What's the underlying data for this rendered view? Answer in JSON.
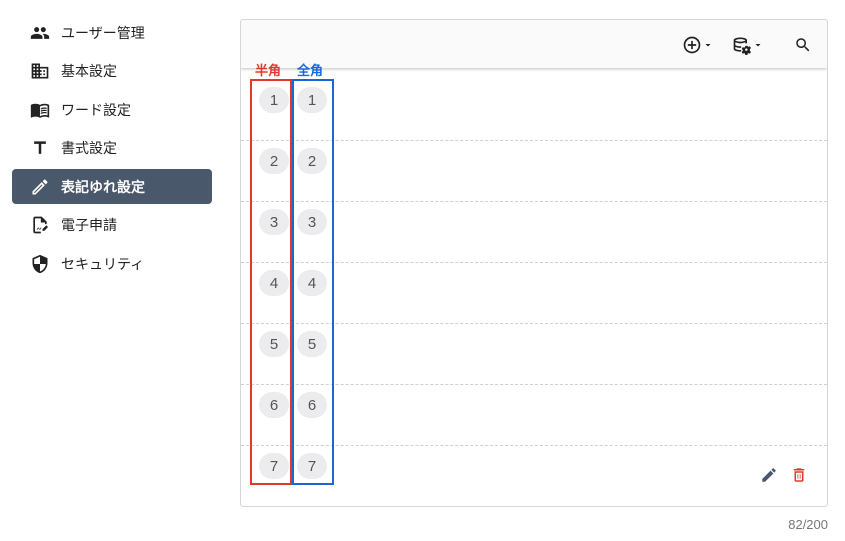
{
  "sidebar": {
    "items": [
      {
        "label": "ユーザー管理",
        "icon": "users-icon",
        "active": false
      },
      {
        "label": "基本設定",
        "icon": "building-icon",
        "active": false
      },
      {
        "label": "ワード設定",
        "icon": "book-icon",
        "active": false
      },
      {
        "label": "書式設定",
        "icon": "text-format-icon",
        "active": false
      },
      {
        "label": "表記ゆれ設定",
        "icon": "pencil-icon",
        "active": true
      },
      {
        "label": "電子申請",
        "icon": "document-sign-icon",
        "active": false
      },
      {
        "label": "セキュリティ",
        "icon": "shield-icon",
        "active": false
      }
    ]
  },
  "toolbar": {
    "buttons": [
      {
        "name": "add-dropdown",
        "icon": "plus-circle-icon"
      },
      {
        "name": "database-settings-dropdown",
        "icon": "database-gear-icon"
      },
      {
        "name": "search",
        "icon": "search-icon"
      }
    ]
  },
  "annotations": {
    "half_width_label": "半角",
    "full_width_label": "全角",
    "half_color": "#e0392b",
    "full_color": "#1a66d6"
  },
  "rows": [
    {
      "half": "1",
      "full": "1"
    },
    {
      "half": "2",
      "full": "2"
    },
    {
      "half": "3",
      "full": "3"
    },
    {
      "half": "4",
      "full": "4"
    },
    {
      "half": "5",
      "full": "5"
    },
    {
      "half": "6",
      "full": "6"
    },
    {
      "half": "7",
      "full": "7"
    }
  ],
  "footer": {
    "counter": "82/200"
  },
  "colors": {
    "active_bg": "#4a586b",
    "delete": "#e0392b",
    "edit": "#4a586b"
  }
}
